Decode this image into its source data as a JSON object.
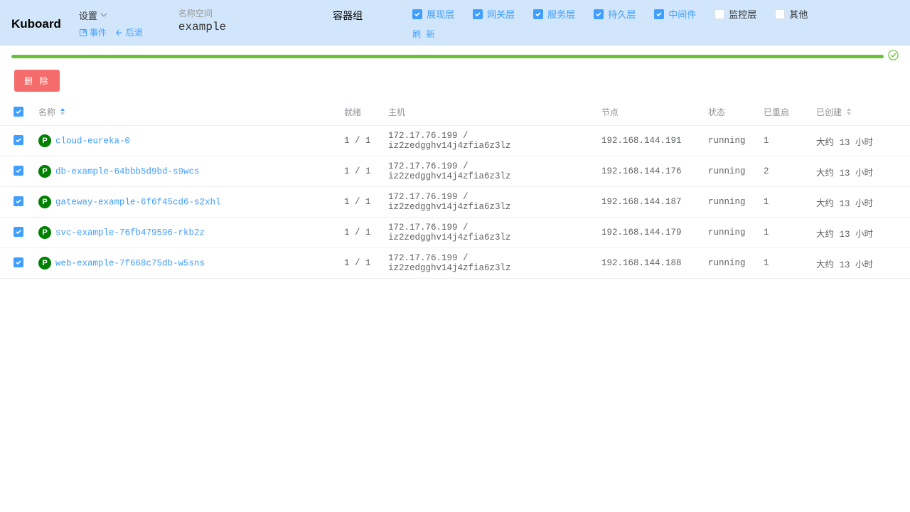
{
  "brand": "Kuboard",
  "settings": {
    "label": "设置",
    "events": "事件",
    "back": "后退"
  },
  "namespace": {
    "label": "名称空间",
    "value": "example"
  },
  "containerGroup": "容器组",
  "filters": [
    {
      "label": "展现层",
      "checked": true,
      "blue": true
    },
    {
      "label": "网关层",
      "checked": true,
      "blue": true
    },
    {
      "label": "服务层",
      "checked": true,
      "blue": true
    },
    {
      "label": "持久层",
      "checked": true,
      "blue": true
    },
    {
      "label": "中间件",
      "checked": true,
      "blue": true
    },
    {
      "label": "监控层",
      "checked": false,
      "blue": false
    },
    {
      "label": "其他",
      "checked": false,
      "blue": false
    }
  ],
  "refresh": "刷 新",
  "deleteBtn": "删 除",
  "columns": {
    "name": "名称",
    "ready": "就绪",
    "host": "主机",
    "node": "节点",
    "status": "状态",
    "restarts": "已重启",
    "created": "已创建"
  },
  "rows": [
    {
      "name": "cloud-eureka-0",
      "ready": "1 / 1",
      "host": "172.17.76.199 / iz2zedgghv14j4zfia6z3lz",
      "node": "192.168.144.191",
      "status": "running",
      "restarts": "1",
      "created": "大约 13 小时"
    },
    {
      "name": "db-example-64bbb5d9bd-s9wcs",
      "ready": "1 / 1",
      "host": "172.17.76.199 / iz2zedgghv14j4zfia6z3lz",
      "node": "192.168.144.176",
      "status": "running",
      "restarts": "2",
      "created": "大约 13 小时"
    },
    {
      "name": "gateway-example-6f6f45cd6-s2xhl",
      "ready": "1 / 1",
      "host": "172.17.76.199 / iz2zedgghv14j4zfia6z3lz",
      "node": "192.168.144.187",
      "status": "running",
      "restarts": "1",
      "created": "大约 13 小时"
    },
    {
      "name": "svc-example-76fb479596-rkb2z",
      "ready": "1 / 1",
      "host": "172.17.76.199 / iz2zedgghv14j4zfia6z3lz",
      "node": "192.168.144.179",
      "status": "running",
      "restarts": "1",
      "created": "大约 13 小时"
    },
    {
      "name": "web-example-7f668c75db-w5sns",
      "ready": "1 / 1",
      "host": "172.17.76.199 / iz2zedgghv14j4zfia6z3lz",
      "node": "192.168.144.188",
      "status": "running",
      "restarts": "1",
      "created": "大约 13 小时"
    }
  ],
  "podBadge": "P"
}
